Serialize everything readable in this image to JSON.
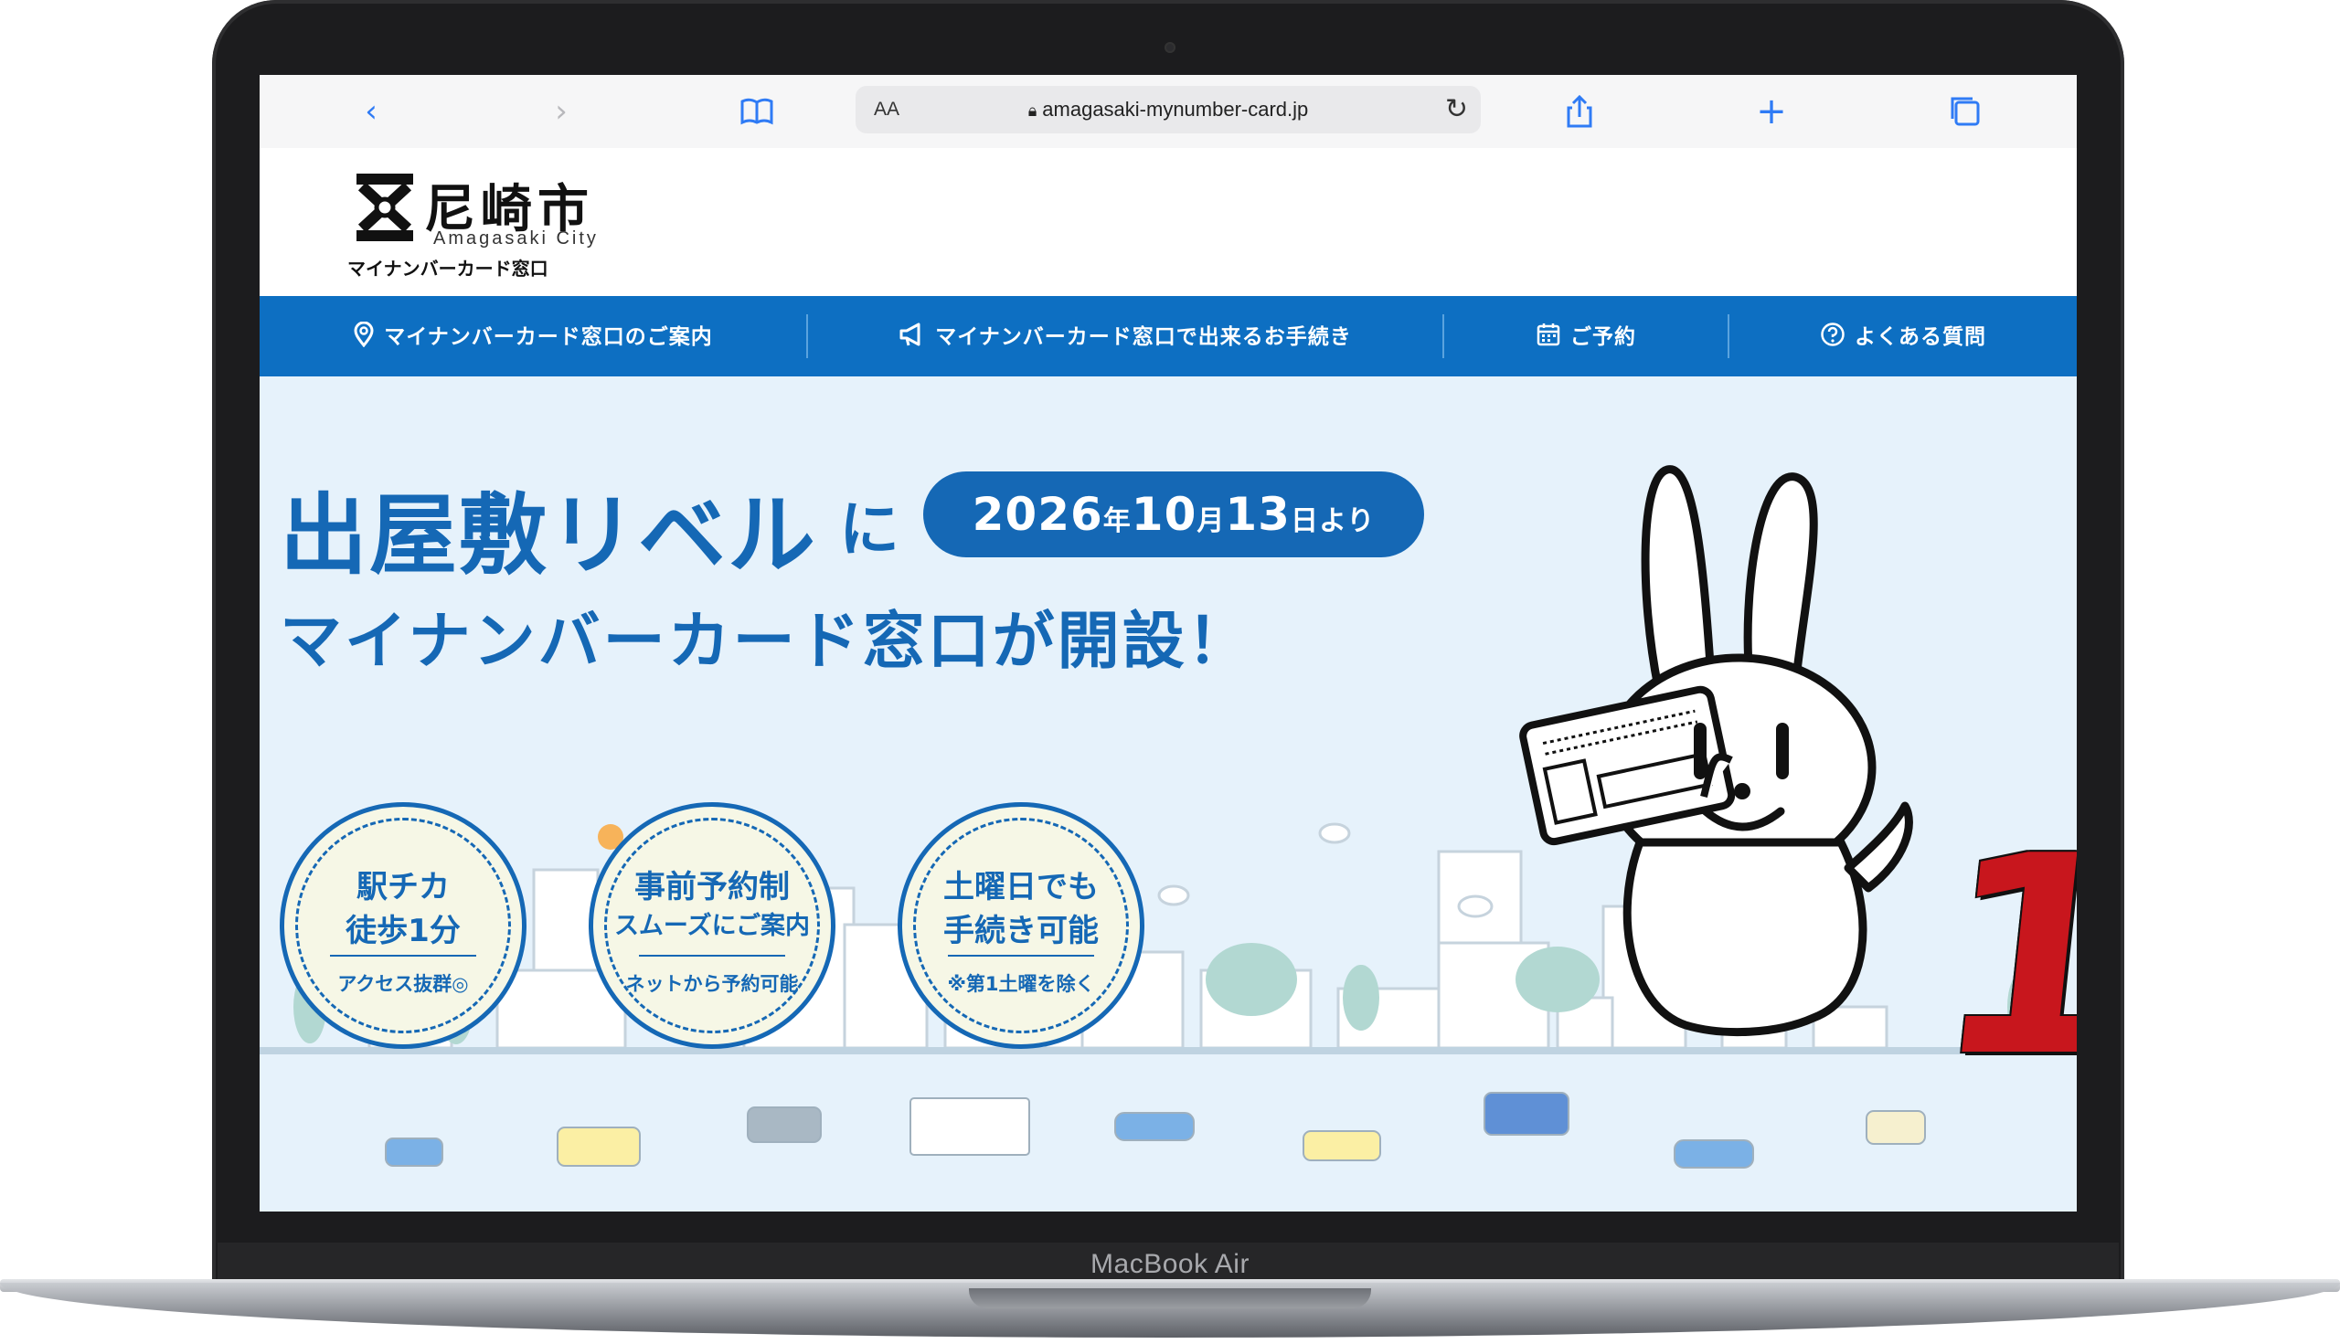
{
  "device": {
    "model_label": "MacBook Air"
  },
  "browser": {
    "address_aa": "AA",
    "url": "amagasaki-mynumber-card.jp",
    "icons": [
      "back-icon",
      "forward-icon",
      "bookmarks-icon",
      "lock-icon",
      "reload-icon",
      "share-icon",
      "new-tab-icon",
      "tabs-icon"
    ]
  },
  "site": {
    "logo_jp": "尼崎市",
    "logo_en": "Amagasaki City",
    "logo_sub": "マイナンバーカード窓口"
  },
  "nav": [
    {
      "label": "マイナンバーカード窓口のご案内",
      "icon": "map-pin-icon"
    },
    {
      "label": "マイナンバーカード窓口で出来るお手続き",
      "icon": "megaphone-icon"
    },
    {
      "label": "ご予約",
      "icon": "calendar-icon"
    },
    {
      "label": "よくある質問",
      "icon": "question-icon"
    }
  ],
  "hero": {
    "title_line1": "出屋敷リベル",
    "title_ni": "に",
    "date_year": "2026",
    "date_nen": "年",
    "date_month": "10",
    "date_gatsu": "月",
    "date_day": "13",
    "date_nichi": "日より",
    "title_line2": "マイナンバーカード窓口が開設！",
    "badges": [
      {
        "line1": "駅チカ",
        "line2": "徒歩1分",
        "small": "アクセス抜群◎"
      },
      {
        "line1": "事前予約制",
        "line2": "スムーズにご案内",
        "small": "ネットから予約可能"
      },
      {
        "line1": "土曜日でも",
        "line2": "手続き可能",
        "small": "※第1土曜を除く"
      }
    ],
    "mascot_number": "1",
    "colors": {
      "primary": "#1568b5",
      "nav": "#0d6fc2",
      "hero_bg": "#e6f2fb",
      "accent_red": "#c8161d"
    }
  }
}
